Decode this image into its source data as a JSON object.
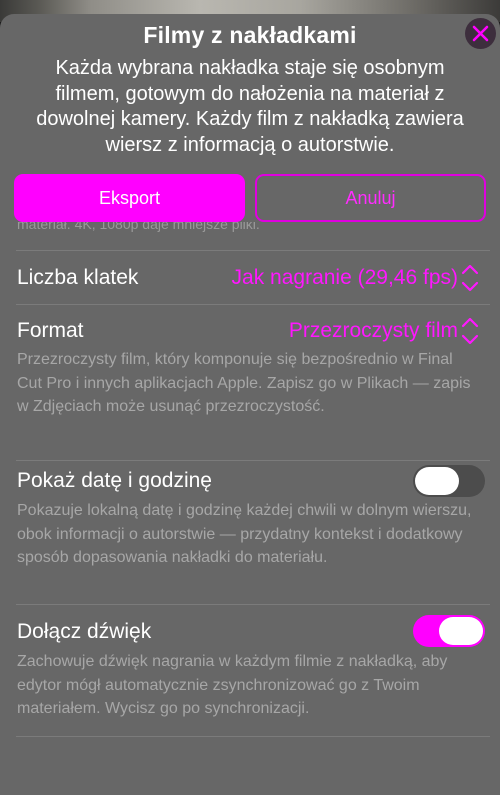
{
  "sheet": {
    "title": "Filmy z nakładkami",
    "subtitle": "Każda wybrana nakładka staje się osobnym filmem, gotowym do nałożenia na materiał z dowolnej kamery. Każdy film z nakładką zawiera wiersz z informacją o autorstwie.",
    "close_icon": "close-x-icon"
  },
  "actions": {
    "export_label": "Eksport",
    "cancel_label": "Anuluj"
  },
  "scrolled_text": "materiał. 4K, 1080p daje mniejsze pliki.",
  "settings": {
    "frame_rate": {
      "label": "Liczba klatek",
      "value": "Jak nagranie (29,46 fps)"
    },
    "format": {
      "label": "Format",
      "value": "Przezroczysty film",
      "description": "Przezroczysty film, który komponuje się bezpośrednio w Final Cut Pro i innych aplikacjach Apple. Zapisz go w Plikach — zapis w Zdjęciach może usunąć przezroczystość."
    },
    "show_datetime": {
      "label": "Pokaż datę i godzinę",
      "enabled": false,
      "description": "Pokazuje lokalną datę i godzinę każdej chwili w dolnym wierszu, obok informacji o autorstwie — przydatny kontekst i dodatkowy sposób dopasowania nakładki do materiału."
    },
    "include_audio": {
      "label": "Dołącz dźwięk",
      "enabled": true,
      "description": "Zachowuje dźwięk nagrania w każdym filmie z nakładką, aby edytor mógł automatycznie zsynchronizować go z Twoim materiałem. Wycisz go po synchronizacji."
    }
  },
  "colors": {
    "accent": "#ff00ff",
    "sheet_background": "#676767",
    "secondary_text": "#a7a7a7"
  }
}
